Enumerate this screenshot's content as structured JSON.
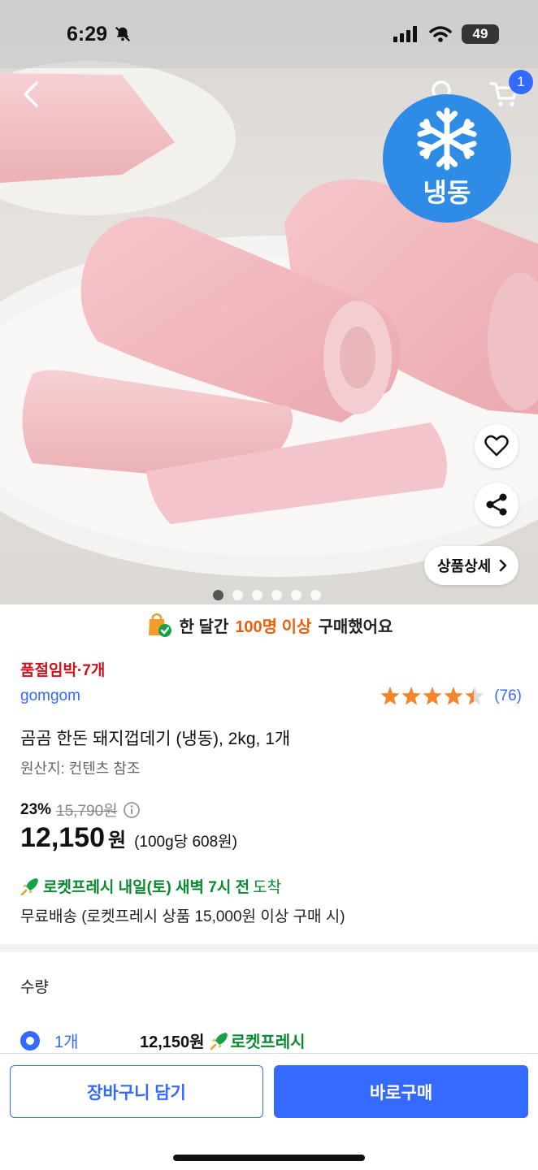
{
  "status_bar": {
    "time": "6:29",
    "battery": "49"
  },
  "hero": {
    "frozen_badge": "냉동",
    "cart_count": "1",
    "detail_button": "상품상세",
    "carousel_dots": 6,
    "carousel_active_index": 0
  },
  "purchase_banner": {
    "prefix": "한 달간",
    "highlight": "100명 이상",
    "suffix": "구매했어요"
  },
  "product": {
    "stock_status": "품절임박·7개",
    "brand": "gomgom",
    "rating": 4.5,
    "review_count": "(76)",
    "title": "곰곰 한돈 돼지껍데기 (냉동), 2kg, 1개",
    "origin": "원산지: 컨텐츠 참조",
    "discount_rate": "23%",
    "original_price": "15,790원",
    "price": "12,150",
    "price_unit": "원",
    "unit_price": "(100g당 608원)",
    "delivery_prefix": "로켓프레시 내일(토) 새벽 7시 전",
    "delivery_suffix": "도착",
    "shipping": "무료배송 (로켓프레시 상품 15,000원 이상 구매 시)"
  },
  "quantity": {
    "label": "수량",
    "option": {
      "count": "1개",
      "price": "12,150원",
      "badge": "로켓프레시"
    }
  },
  "bottom_bar": {
    "cart_button": "장바구니 담기",
    "buy_button": "바로구매"
  },
  "colors": {
    "accent": "#346aff",
    "rocket_green": "#0a8a2e",
    "stock_red": "#d0101b",
    "banner_orange": "#e8610a",
    "frozen_blue": "#2e8be6"
  }
}
